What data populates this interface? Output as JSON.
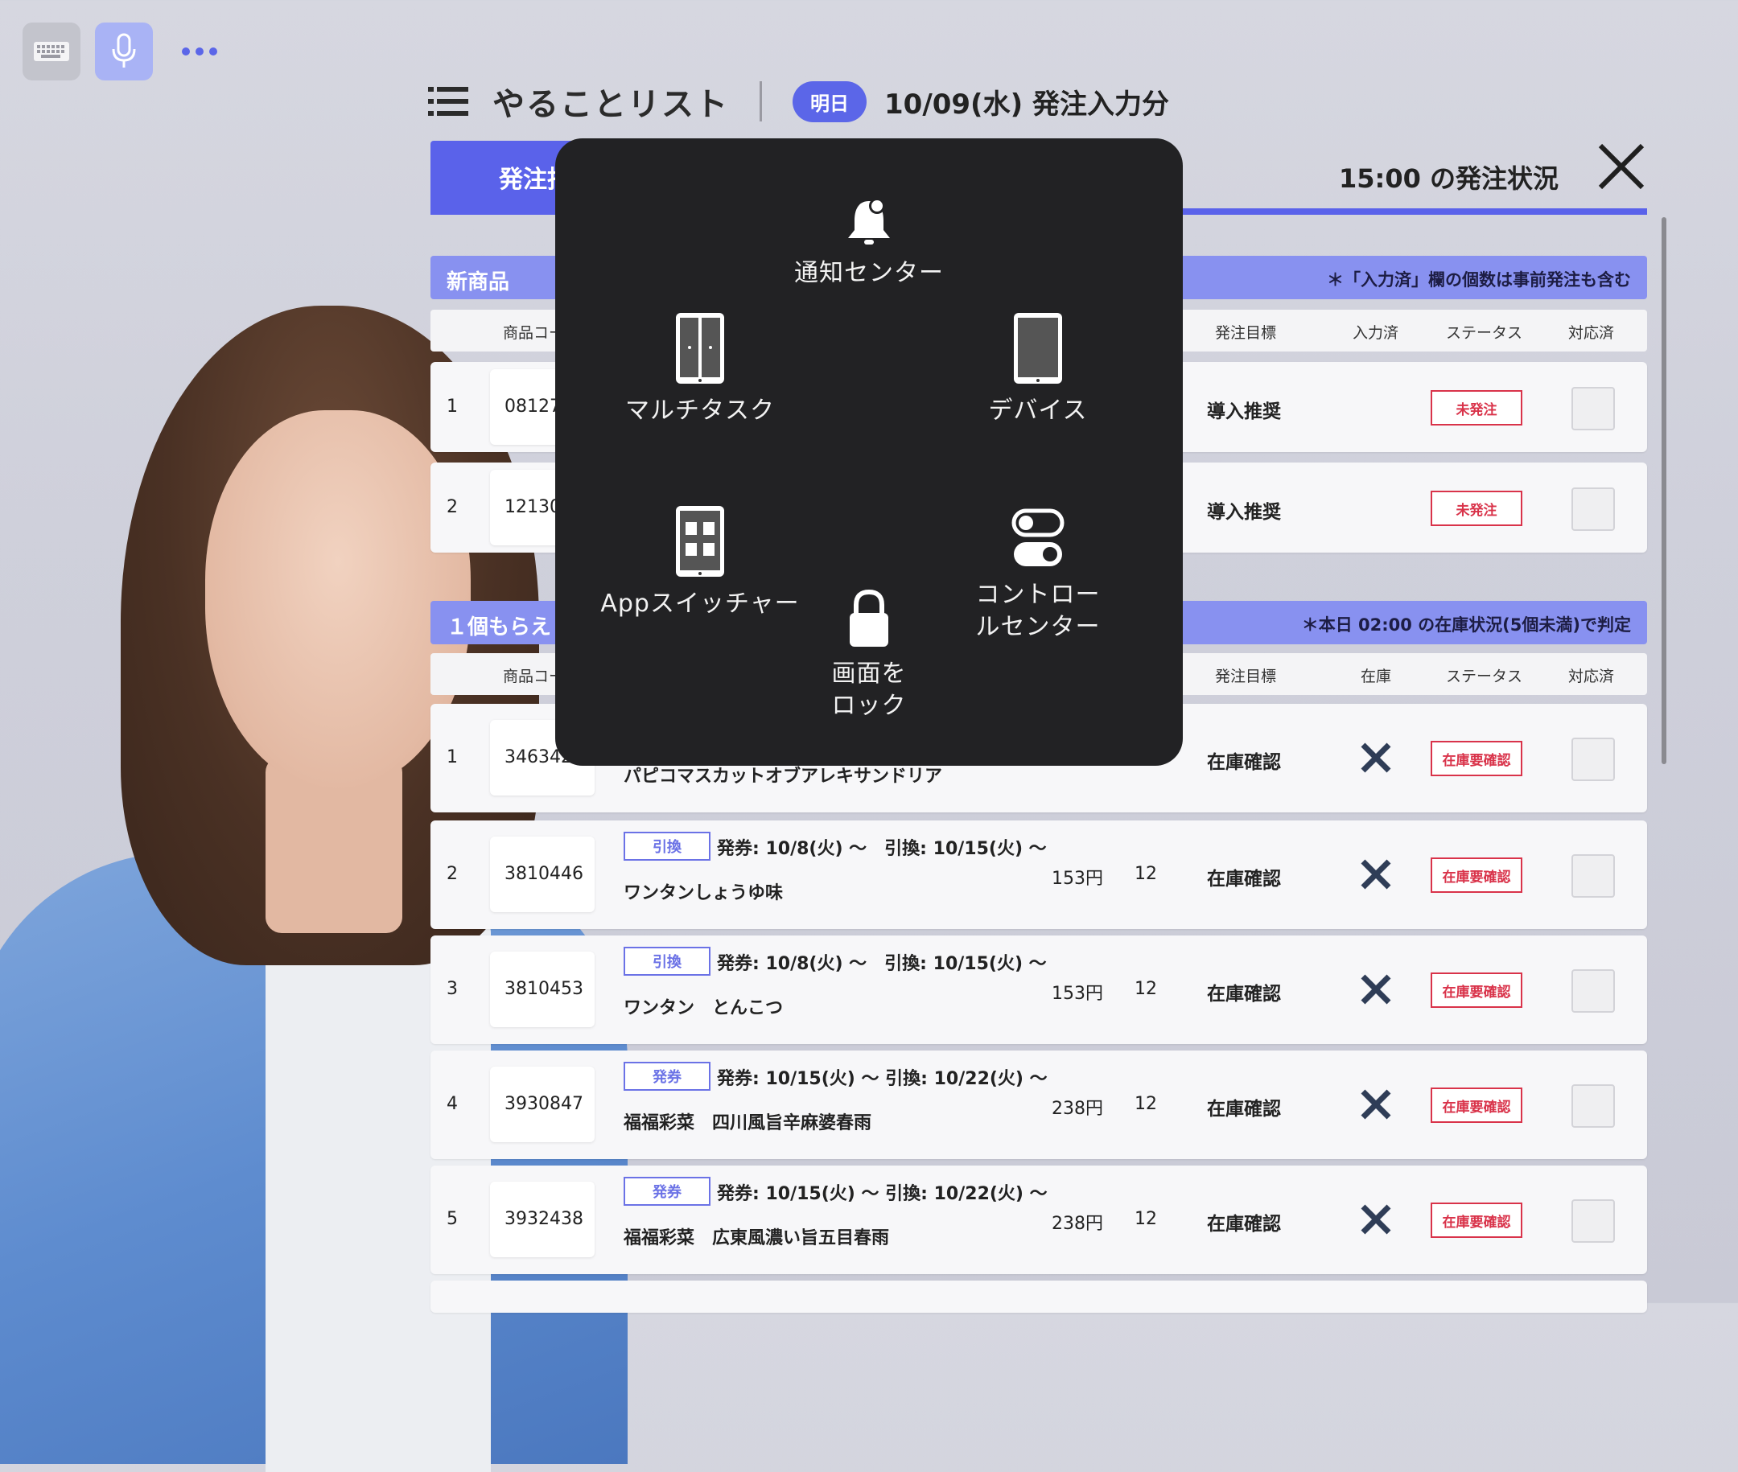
{
  "header": {
    "title": "やることリスト",
    "badge": "明日",
    "date_title": "10/09(水) 発注入力分"
  },
  "panel": {
    "active_tab": "発注指",
    "status_time": "15:00 の発注状況"
  },
  "section1": {
    "label": "新商品",
    "note": "＊「入力済」欄の個数は事前発注も含む",
    "columns": {
      "code": "商品コー",
      "target": "発注目標",
      "entered": "入力済",
      "status": "ステータス",
      "done": "対応済"
    },
    "rows": [
      {
        "idx": "1",
        "code": "08127",
        "target": "導入推奨",
        "status": "未発注"
      },
      {
        "idx": "2",
        "code": "12130",
        "target": "導入推奨",
        "status": "未発注"
      }
    ]
  },
  "section2": {
    "label": "１個もらえ",
    "note": "＊本日 02:00 の在庫状況(5個未満)で判定",
    "columns": {
      "code": "商品コー",
      "target": "発注目標",
      "stock": "在庫",
      "status": "ステータス",
      "done": "対応済"
    },
    "rows": [
      {
        "idx": "1",
        "code": "3463420",
        "tag": "",
        "period": "",
        "name": "パピコマスカットオブアレキサンドリア",
        "price": "",
        "qty": "",
        "target": "在庫確認",
        "status": "在庫要確認"
      },
      {
        "idx": "2",
        "code": "3810446",
        "tag": "引換",
        "period": "発券: 10/8(火) 〜　引換: 10/15(火) 〜",
        "name": "ワンタンしょうゆ味",
        "price": "153円",
        "qty": "12",
        "target": "在庫確認",
        "status": "在庫要確認"
      },
      {
        "idx": "3",
        "code": "3810453",
        "tag": "引換",
        "period": "発券: 10/8(火) 〜　引換: 10/15(火) 〜",
        "name": "ワンタン　とんこつ",
        "price": "153円",
        "qty": "12",
        "target": "在庫確認",
        "status": "在庫要確認"
      },
      {
        "idx": "4",
        "code": "3930847",
        "tag": "発券",
        "period": "発券: 10/15(火) 〜 引換: 10/22(火) 〜",
        "name": "福福彩菜　四川風旨辛麻婆春雨",
        "price": "238円",
        "qty": "12",
        "target": "在庫確認",
        "status": "在庫要確認"
      },
      {
        "idx": "5",
        "code": "3932438",
        "tag": "発券",
        "period": "発券: 10/15(火) 〜 引換: 10/22(火) 〜",
        "name": "福福彩菜　広東風濃い旨五目春雨",
        "price": "238円",
        "qty": "12",
        "target": "在庫確認",
        "status": "在庫要確認"
      }
    ]
  },
  "assistive_menu": {
    "notification_center": "通知センター",
    "multitask": "マルチタスク",
    "device": "デバイス",
    "app_switcher": "Appスイッチャー",
    "control_center_l1": "コントロー",
    "control_center_l2": "ルセンター",
    "lock_l1": "画面を",
    "lock_l2": "ロック"
  },
  "colors": {
    "accent": "#5a62ea",
    "status_red": "#d9334a",
    "overlay": "#222224"
  },
  "icons": [
    "keyboard-icon",
    "microphone-icon",
    "more-dots-icon",
    "list-menu-icon",
    "close-icon",
    "bell-icon",
    "multitask-icon",
    "tablet-icon",
    "app-switcher-icon",
    "toggle-icon",
    "lock-icon",
    "x-mark-icon"
  ]
}
